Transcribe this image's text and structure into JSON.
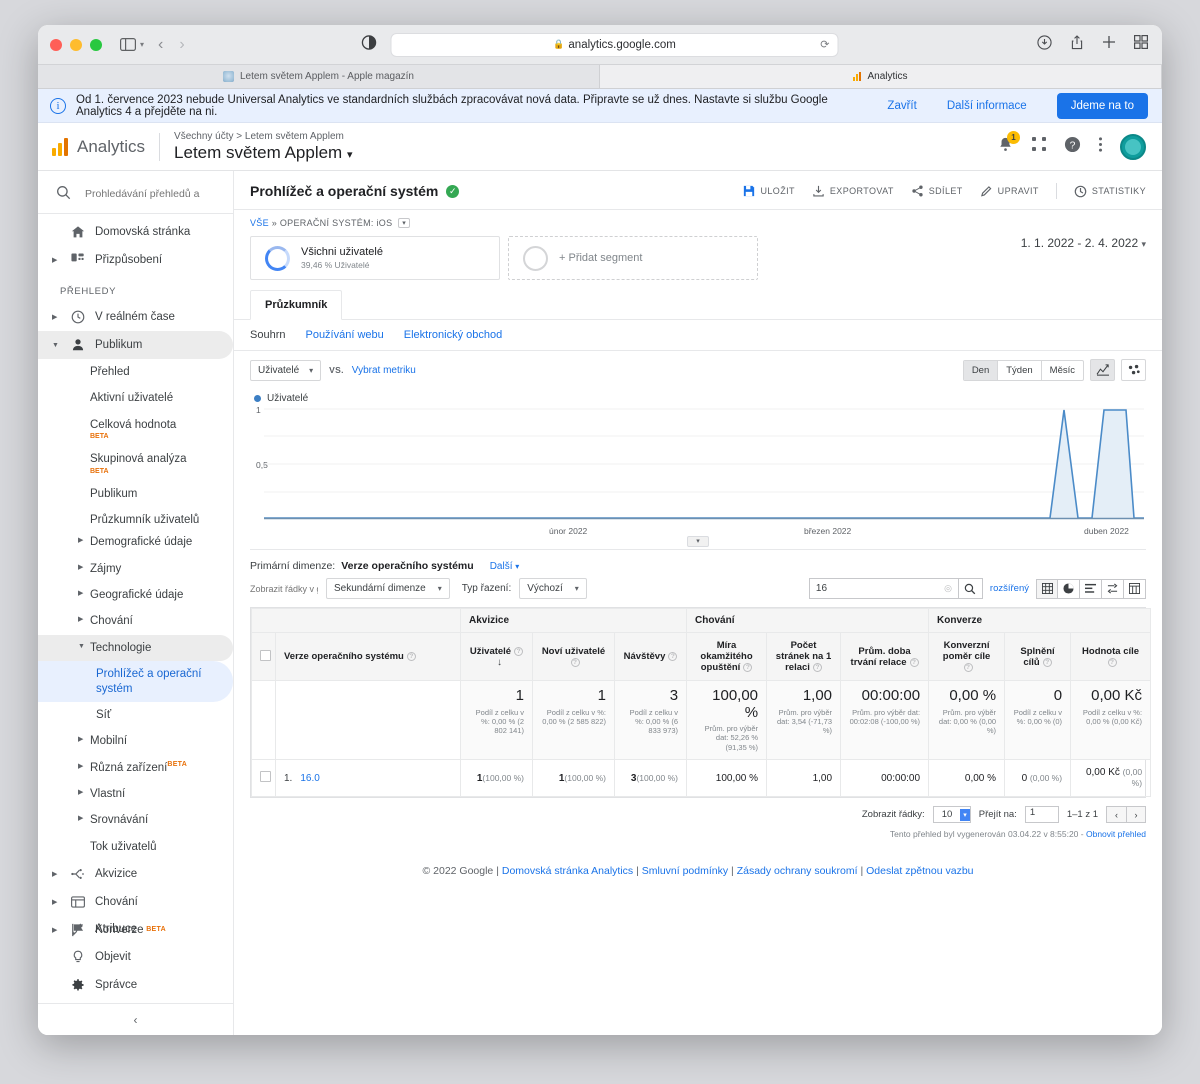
{
  "browser": {
    "url": "analytics.google.com",
    "lock_icon": "lock-icon",
    "reload_icon": "reload-icon",
    "tabs": [
      {
        "title": "Letem světem Applem - Apple magazín",
        "favicon": "apple-favicon",
        "active": false
      },
      {
        "title": "Analytics",
        "favicon": "analytics-favicon",
        "active": true
      }
    ]
  },
  "banner": {
    "message": "Od 1. července 2023 nebude Universal Analytics ve standardních službách zpracovávat nová data. Připravte se už dnes. Nastavte si službu Google Analytics 4 a přejděte na ni.",
    "close_label": "Zavřít",
    "more_label": "Další informace",
    "cta_label": "Jdeme na to"
  },
  "header": {
    "brand": "Analytics",
    "breadcrumb": "Všechny účty > Letem světem Applem",
    "property": "Letem světem Applem",
    "notifications_count": "1"
  },
  "sidebar": {
    "search_placeholder": "Prohledávání přehledů a nás",
    "top_items": [
      {
        "label": "Domovská stránka",
        "icon": "home-icon",
        "expandable": false
      },
      {
        "label": "Přizpůsobení",
        "icon": "customization-icon",
        "expandable": true
      }
    ],
    "section_label": "PŘEHLEDY",
    "reports": [
      {
        "label": "V reálném čase",
        "icon": "clock-icon",
        "expandable": true,
        "selected": false
      },
      {
        "label": "Publikum",
        "icon": "person-icon",
        "expandable": true,
        "selected": true
      }
    ],
    "audience_sub": [
      {
        "label": "Přehled",
        "badge": "",
        "expandable": false
      },
      {
        "label": "Aktivní uživatelé",
        "badge": "",
        "expandable": false
      },
      {
        "label": "Celková hodnota",
        "badge": "BETA",
        "expandable": false
      },
      {
        "label": "Skupinová analýza",
        "badge": "BETA",
        "expandable": false
      },
      {
        "label": "Publikum",
        "badge": "",
        "expandable": false
      },
      {
        "label": "Průzkumník uživatelů",
        "badge": "",
        "expandable": false
      },
      {
        "label": "Demografické údaje",
        "badge": "",
        "expandable": true
      },
      {
        "label": "Zájmy",
        "badge": "",
        "expandable": true
      },
      {
        "label": "Geografické údaje",
        "badge": "",
        "expandable": true
      },
      {
        "label": "Chování",
        "badge": "",
        "expandable": true
      },
      {
        "label": "Technologie",
        "badge": "",
        "expandable": true,
        "open": true
      }
    ],
    "tech_sub": [
      {
        "label": "Prohlížeč a operační systém",
        "active": true
      },
      {
        "label": "Síť",
        "active": false
      }
    ],
    "audience_sub_tail": [
      {
        "label": "Mobilní",
        "badge": "",
        "expandable": true
      },
      {
        "label": "Různá zařízení",
        "badge": "BETA",
        "expandable": true
      },
      {
        "label": "Vlastní",
        "badge": "",
        "expandable": true
      },
      {
        "label": "Srovnávání",
        "badge": "",
        "expandable": true
      },
      {
        "label": "Tok uživatelů",
        "badge": "",
        "expandable": false
      }
    ],
    "bottom_reports": [
      {
        "label": "Akvizice",
        "icon": "acquisition-icon"
      },
      {
        "label": "Chování",
        "icon": "behavior-icon"
      },
      {
        "label": "Konverze",
        "icon": "flag-icon"
      }
    ],
    "footer_items": [
      {
        "label": "Atribuce",
        "icon": "attribution-icon",
        "badge": "BETA"
      },
      {
        "label": "Objevit",
        "icon": "bulb-icon",
        "badge": ""
      },
      {
        "label": "Správce",
        "icon": "gear-icon",
        "badge": ""
      }
    ],
    "collapse_icon": "chevron-left-icon"
  },
  "report": {
    "title": "Prohlížeč a operační systém",
    "verified_icon": "verified-check-icon",
    "actions": [
      {
        "label": "ULOŽIT",
        "icon": "save-icon"
      },
      {
        "label": "EXPORTOVAT",
        "icon": "export-icon"
      },
      {
        "label": "SDÍLET",
        "icon": "share-icon"
      },
      {
        "label": "UPRAVIT",
        "icon": "edit-icon"
      },
      {
        "label": "STATISTIKY",
        "icon": "insights-icon"
      }
    ],
    "segment_crumb_all": "VŠE",
    "segment_crumb_current": "OPERAČNÍ SYSTÉM: iOS",
    "date_range": "1. 1. 2022 - 2. 4. 2022",
    "segments": [
      {
        "name": "Všichni uživatelé",
        "sub": "39,46 % Uživatelé"
      }
    ],
    "add_segment_label": "+ Přidat segment",
    "explorer_tab": "Průzkumník",
    "subtabs": [
      {
        "label": "Souhrn",
        "active": true
      },
      {
        "label": "Používání webu",
        "active": false
      },
      {
        "label": "Elektronický obchod",
        "active": false
      }
    ]
  },
  "chart_controls": {
    "metric": "Uživatelé",
    "vs_label": "VS.",
    "pick_metric": "Vybrat metriku",
    "granularity": [
      {
        "label": "Den",
        "active": true
      },
      {
        "label": "Týden",
        "active": false
      },
      {
        "label": "Měsíc",
        "active": false
      }
    ],
    "chart_type_icon": "line-chart-icon",
    "scatter_icon": "scatter-icon"
  },
  "chart_data": {
    "type": "area",
    "title": "Uživatelé",
    "legend": [
      "Uživatelé"
    ],
    "legend_position": "top-left",
    "xlabel": "",
    "ylabel": "",
    "ylim": [
      0,
      1
    ],
    "ytick_labels": [
      "1",
      "0,5"
    ],
    "ytick_values": [
      1,
      0.5
    ],
    "xtick_labels": [
      "únor 2022",
      "březen 2022",
      "duben 2022"
    ],
    "grid": true,
    "series": [
      {
        "name": "Uživatelé",
        "color": "#4b8bc8",
        "x": [
          "2022-01-01",
          "2022-03-25",
          "2022-03-27",
          "2022-03-29",
          "2022-03-31",
          "2022-04-01",
          "2022-04-02"
        ],
        "values": [
          0,
          0,
          1,
          0,
          0,
          1,
          1
        ]
      }
    ],
    "note": "Flat at 0 from 1. 1. 2022 until late March; two narrow spikes reaching 1 user near the end of March / start of April 2022."
  },
  "table_controls": {
    "primary_dimension_label": "Primární dimenze:",
    "primary_dimension_value": "Verze operačního systému",
    "more_label": "Další",
    "plot_rows_placeholder": "Zobrazit řádky v grafu",
    "secondary_dimension": "Sekundární dimenze",
    "sort_type_label": "Typ řazení:",
    "sort_type_value": "Výchozí",
    "search_value": "16",
    "advanced_label": "rozšířený",
    "view_icons": [
      "table-view-icon",
      "pie-view-icon",
      "performance-view-icon",
      "comparison-view-icon",
      "pivot-view-icon"
    ]
  },
  "table": {
    "groups": [
      {
        "label": "",
        "span": 2
      },
      {
        "label": "Akvizice",
        "span": 3
      },
      {
        "label": "Chování",
        "span": 3
      },
      {
        "label": "Konverze",
        "span": 3
      }
    ],
    "dimension_header": "Verze operačního systému",
    "columns": [
      {
        "label": "Uživatelé",
        "sorted": true
      },
      {
        "label": "Noví uživatelé",
        "sorted": false
      },
      {
        "label": "Návštěvy",
        "sorted": false
      },
      {
        "label": "Míra okamžitého opuštění",
        "sorted": false
      },
      {
        "label": "Počet stránek na 1 relaci",
        "sorted": false
      },
      {
        "label": "Prům. doba trvání relace",
        "sorted": false
      },
      {
        "label": "Konverzní poměr cíle",
        "sorted": false
      },
      {
        "label": "Splnění cílů",
        "sorted": false
      },
      {
        "label": "Hodnota cíle",
        "sorted": false
      }
    ],
    "summary": [
      {
        "big": "1",
        "sub": "Podíl z celku v %: 0,00 % (2 802 141)"
      },
      {
        "big": "1",
        "sub": "Podíl z celku v %: 0,00 % (2 585 822)"
      },
      {
        "big": "3",
        "sub": "Podíl z celku v %: 0,00 % (6 833 973)"
      },
      {
        "big": "100,00 %",
        "sub": "Prům. pro výběr dat: 52,26 % (91,35 %)"
      },
      {
        "big": "1,00",
        "sub": "Prům. pro výběr dat: 3,54 (-71,73 %)"
      },
      {
        "big": "00:00:00",
        "sub": "Prům. pro výběr dat: 00:02:08 (-100,00 %)"
      },
      {
        "big": "0,00 %",
        "sub": "Prům. pro výběr dat: 0,00 % (0,00 %)"
      },
      {
        "big": "0",
        "sub": "Podíl z celku v %: 0,00 % (0)"
      },
      {
        "big": "0,00 Kč",
        "sub": "Podíl z celku v %: 0,00 % (0,00 Kč)"
      }
    ],
    "rows": [
      {
        "index": "1.",
        "dimension": "16.0",
        "cells": [
          {
            "value": "1",
            "pct": "(100,00 %)"
          },
          {
            "value": "1",
            "pct": "(100,00 %)"
          },
          {
            "value": "3",
            "pct": "(100,00 %)"
          },
          {
            "value": "100,00 %",
            "pct": ""
          },
          {
            "value": "1,00",
            "pct": ""
          },
          {
            "value": "00:00:00",
            "pct": ""
          },
          {
            "value": "0,00 %",
            "pct": ""
          },
          {
            "value": "0",
            "pct": "(0,00 %)"
          },
          {
            "value": "0,00 Kč",
            "pct": "(0,00 %)"
          }
        ]
      }
    ]
  },
  "pagination": {
    "rows_label": "Zobrazit řádky:",
    "rows_value": "10",
    "goto_label": "Přejít na:",
    "goto_value": "1",
    "range": "1–1 z 1",
    "prev_icon": "chevron-left-icon",
    "next_icon": "chevron-right-icon",
    "generated_text": "Tento přehled byl vygenerován 03.04.22 v 8:55:20 -",
    "refresh_label": "Obnovit přehled"
  },
  "footer": {
    "copyright": "© 2022 Google",
    "links": [
      "Domovská stránka Analytics",
      "Smluvní podmínky",
      "Zásady ochrany soukromí",
      "Odeslat zpětnou vazbu"
    ]
  },
  "colors": {
    "accent": "#1a73e8",
    "chart_line": "#4b8bc8",
    "verified": "#34a853",
    "beta": "#e8710a",
    "banner_bg": "#e8f0fe"
  }
}
